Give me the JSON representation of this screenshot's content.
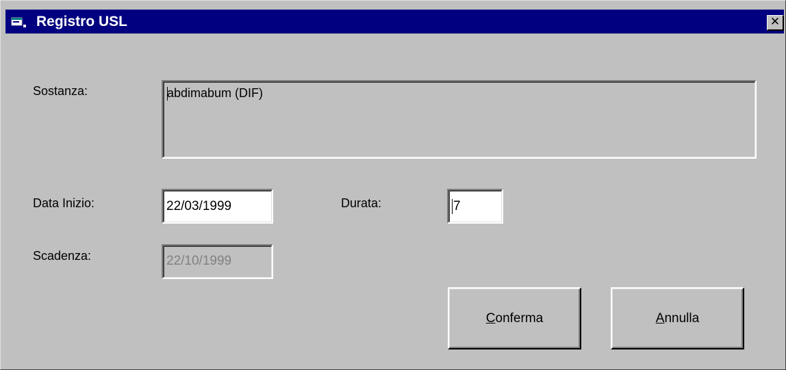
{
  "window": {
    "title": "Registro USL",
    "close_label": "✕"
  },
  "form": {
    "sostanza": {
      "label": "Sostanza:",
      "value": "abdimabum (DIF)"
    },
    "data_inizio": {
      "label": "Data Inizio:",
      "value": "22/03/1999"
    },
    "durata": {
      "label": "Durata:",
      "value": "7"
    },
    "scadenza": {
      "label": "Scadenza:",
      "value": "22/10/1999"
    }
  },
  "buttons": {
    "confirm": {
      "mnemonic": "C",
      "rest": "onferma"
    },
    "cancel": {
      "mnemonic": "A",
      "rest": "nnulla"
    }
  },
  "icons": {
    "title_icon": "app-window-icon",
    "close_icon": "close-icon"
  },
  "colors": {
    "titlebar": "#000080",
    "face": "#c0c0c0",
    "disabled_text": "#808080"
  }
}
